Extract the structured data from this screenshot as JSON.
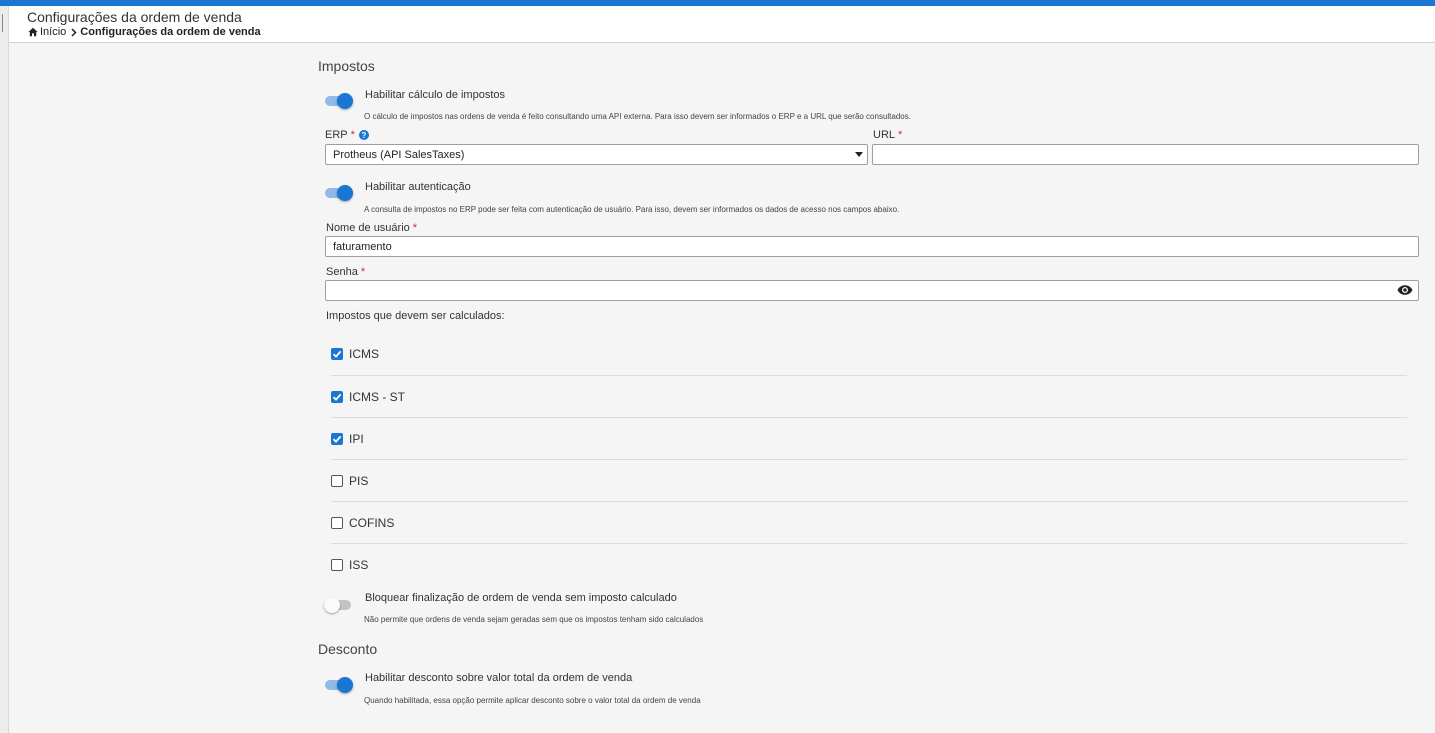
{
  "header": {
    "title": "Configurações da ordem de venda",
    "breadcrumb": {
      "home": "Início",
      "current": "Configurações da ordem de venda"
    }
  },
  "sections": {
    "impostos": "Impostos",
    "desconto": "Desconto"
  },
  "tax_calc": {
    "label": "Habilitar cálculo de impostos",
    "enabled": true,
    "description": "O cálculo de impostos nas ordens de venda é feito consultando uma API externa. Para isso devem ser informados o ERP e a URL que serão consultados."
  },
  "erp": {
    "label": "ERP",
    "required": "*",
    "help_icon": "?",
    "value": "Protheus (API SalesTaxes)"
  },
  "url": {
    "label": "URL",
    "required": "*",
    "value": ""
  },
  "auth": {
    "label": "Habilitar autenticação",
    "enabled": true,
    "description": "A consulta de impostos no ERP pode ser feita com autenticação de usuário. Para isso, devem ser informados os dados de acesso nos campos abaixo."
  },
  "username": {
    "label": "Nome de usuário",
    "required": "*",
    "value": "faturamento"
  },
  "password": {
    "label": "Senha",
    "required": "*",
    "value": ""
  },
  "taxes": {
    "label": "Impostos que devem ser calculados:",
    "items": [
      {
        "name": "ICMS",
        "checked": true
      },
      {
        "name": "ICMS - ST",
        "checked": true
      },
      {
        "name": "IPI",
        "checked": true
      },
      {
        "name": "PIS",
        "checked": false
      },
      {
        "name": "COFINS",
        "checked": false
      },
      {
        "name": "ISS",
        "checked": false
      }
    ]
  },
  "block": {
    "label": "Bloquear finalização de ordem de venda sem imposto calculado",
    "enabled": false,
    "description": "Não permite que ordens de venda sejam geradas sem que os impostos tenham sido calculados"
  },
  "discount": {
    "label": "Habilitar desconto sobre valor total da ordem de venda",
    "enabled": true,
    "description": "Quando habilitada, essa opção permite aplicar desconto sobre o valor total da ordem de venda"
  },
  "colors": {
    "accent": "#1976d2",
    "required": "#d32f2f"
  }
}
